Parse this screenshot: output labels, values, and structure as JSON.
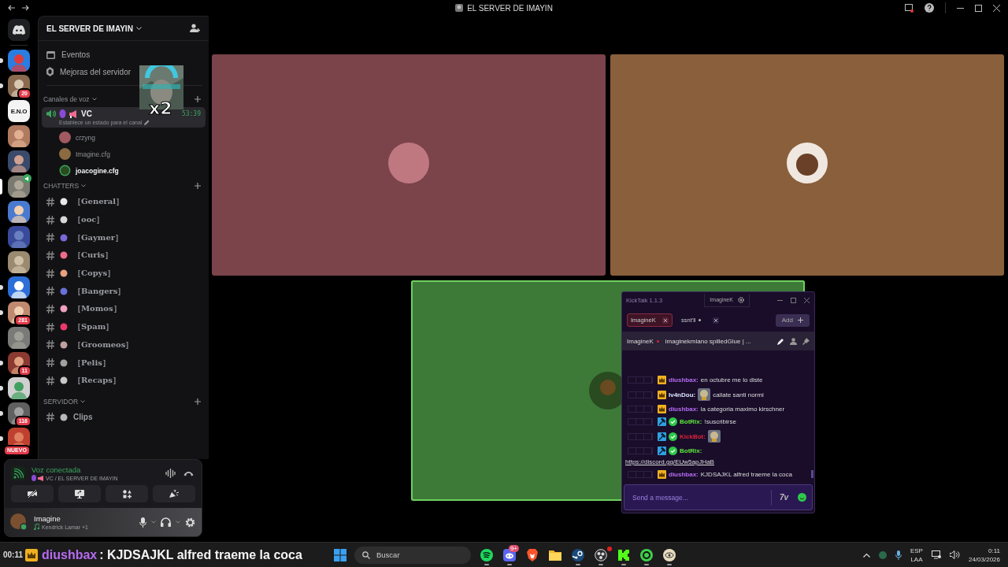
{
  "window": {
    "title": "EL SERVER DE IMAYIN"
  },
  "servers": [
    {
      "unread": true,
      "selected": false
    },
    {
      "unread": true,
      "selected": false,
      "badge": "20"
    },
    {
      "unread": false,
      "selected": false,
      "label": "E.N.O"
    },
    {
      "unread": false,
      "selected": false
    },
    {
      "unread": false,
      "selected": false
    },
    {
      "unread": false,
      "selected": true,
      "voice": true
    },
    {
      "unread": false,
      "selected": false
    },
    {
      "unread": false,
      "selected": false
    },
    {
      "unread": false,
      "selected": false
    },
    {
      "unread": true,
      "selected": false
    },
    {
      "unread": true,
      "selected": false,
      "badge": "281"
    },
    {
      "unread": false,
      "selected": false
    },
    {
      "unread": true,
      "selected": false,
      "badge": "11"
    },
    {
      "unread": true,
      "selected": false
    },
    {
      "unread": true,
      "selected": false,
      "badge": "116"
    },
    {
      "unread": true,
      "selected": false,
      "badge": "NUEVO"
    }
  ],
  "server": {
    "name": "EL SERVER DE IMAYIN",
    "links": [
      {
        "label": "Eventos"
      },
      {
        "label": "Mejoras del servidor"
      }
    ],
    "sticker": {
      "caption": "x2"
    },
    "voice_category": "Canales de voz",
    "voice_channel": {
      "name": "VC",
      "timer": "53:39",
      "status": "Establece un estado para el canal",
      "selected": true
    },
    "voice_members": [
      {
        "name": "crzyng",
        "speaking": false
      },
      {
        "name": "Imagine.cfg",
        "speaking": false
      },
      {
        "name": "joacogine.cfg",
        "speaking": true
      }
    ],
    "categories": [
      {
        "name": "CHATTERS",
        "channels": [
          {
            "name": "［General］"
          },
          {
            "name": "［ooc］"
          },
          {
            "name": "［Gaymer］"
          },
          {
            "name": "［Curis］"
          },
          {
            "name": "［Copys］"
          },
          {
            "name": "［Bangers］"
          },
          {
            "name": "［Momos］"
          },
          {
            "name": "［Spam］"
          },
          {
            "name": "［Groomeos］"
          },
          {
            "name": "［Pelis］"
          },
          {
            "name": "［Recaps］"
          }
        ]
      },
      {
        "name": "SERVIDOR",
        "channels": [
          {
            "name": "Clips"
          }
        ]
      }
    ]
  },
  "voice_panel": {
    "status": "Voz conectada",
    "location": "VC / EL SERVER DE IMAYIN"
  },
  "user_panel": {
    "name": "Imagine",
    "activity": "Kendrick Lamar +1"
  },
  "video_tiles": [
    {
      "color": "#7b434a",
      "speaking": false
    },
    {
      "color": "#8a5f3b",
      "speaking": false
    },
    {
      "color": "#3d7a38",
      "speaking": true
    }
  ],
  "kicktalk": {
    "title": "KickTalk 1.1.3",
    "account": "ImagineK",
    "tabs": [
      {
        "label": "ImagineK",
        "selected": true,
        "unread": false
      },
      {
        "label": "ssnt'li",
        "selected": false,
        "unread": true
      }
    ],
    "add_button": "Add",
    "stream": {
      "channel": "ImagineK",
      "live": true,
      "title": "imaginekmiano spilledGlue | ..."
    },
    "messages": [
      {
        "user": "diushbax:",
        "color": "#b56cf0",
        "kind": "crown",
        "verified": false,
        "emote": false,
        "text": "en octubre me lo diste"
      },
      {
        "user": "Iv4nDou:",
        "color": "#dfe6ff",
        "kind": "crown",
        "verified": false,
        "emote": true,
        "text": "callate santi normi"
      },
      {
        "user": "diushbax:",
        "color": "#b56cf0",
        "kind": "crown",
        "verified": false,
        "emote": false,
        "text": "la categoria maximo kirschner"
      },
      {
        "user": "BotRix:",
        "color": "#5ee83a",
        "kind": "mod",
        "verified": true,
        "emote": false,
        "text": "!suscribirse"
      },
      {
        "user": "KickBot:",
        "color": "#e0223a",
        "kind": "mod",
        "verified": true,
        "emote": true
      },
      {
        "user": "BotRix:",
        "color": "#5ee83a",
        "kind": "mod",
        "verified": true,
        "emote": false,
        "link": "https://discord.gg/EUw5apJHaB"
      },
      {
        "user": "diushbax:",
        "color": "#b56cf0",
        "kind": "crown",
        "verified": false,
        "emote": false,
        "text": "KJDSAJKL alfred traeme la coca"
      }
    ],
    "input": {
      "placeholder": "Send a message..."
    },
    "emote_button": "7v"
  },
  "chat_overlay": {
    "time": "00:11",
    "user": "diushbax",
    "text": ": KJDSAJKL alfred traeme la coca"
  },
  "taskbar": {
    "search": {
      "placeholder": "Buscar"
    },
    "apps": [
      {
        "kind": "music",
        "running": true
      },
      {
        "kind": "chat",
        "running": true,
        "badge": "9+"
      },
      {
        "kind": "browser",
        "running": false
      },
      {
        "kind": "folder",
        "running": false
      },
      {
        "kind": "game",
        "running": true
      },
      {
        "kind": "record",
        "running": true,
        "alert": true
      },
      {
        "kind": "stream",
        "running": true
      },
      {
        "kind": "ring",
        "running": true
      },
      {
        "kind": "eye",
        "running": true
      }
    ],
    "language": [
      "ESP",
      "LAA"
    ],
    "time": "0:11",
    "date": "24/03/2026"
  }
}
